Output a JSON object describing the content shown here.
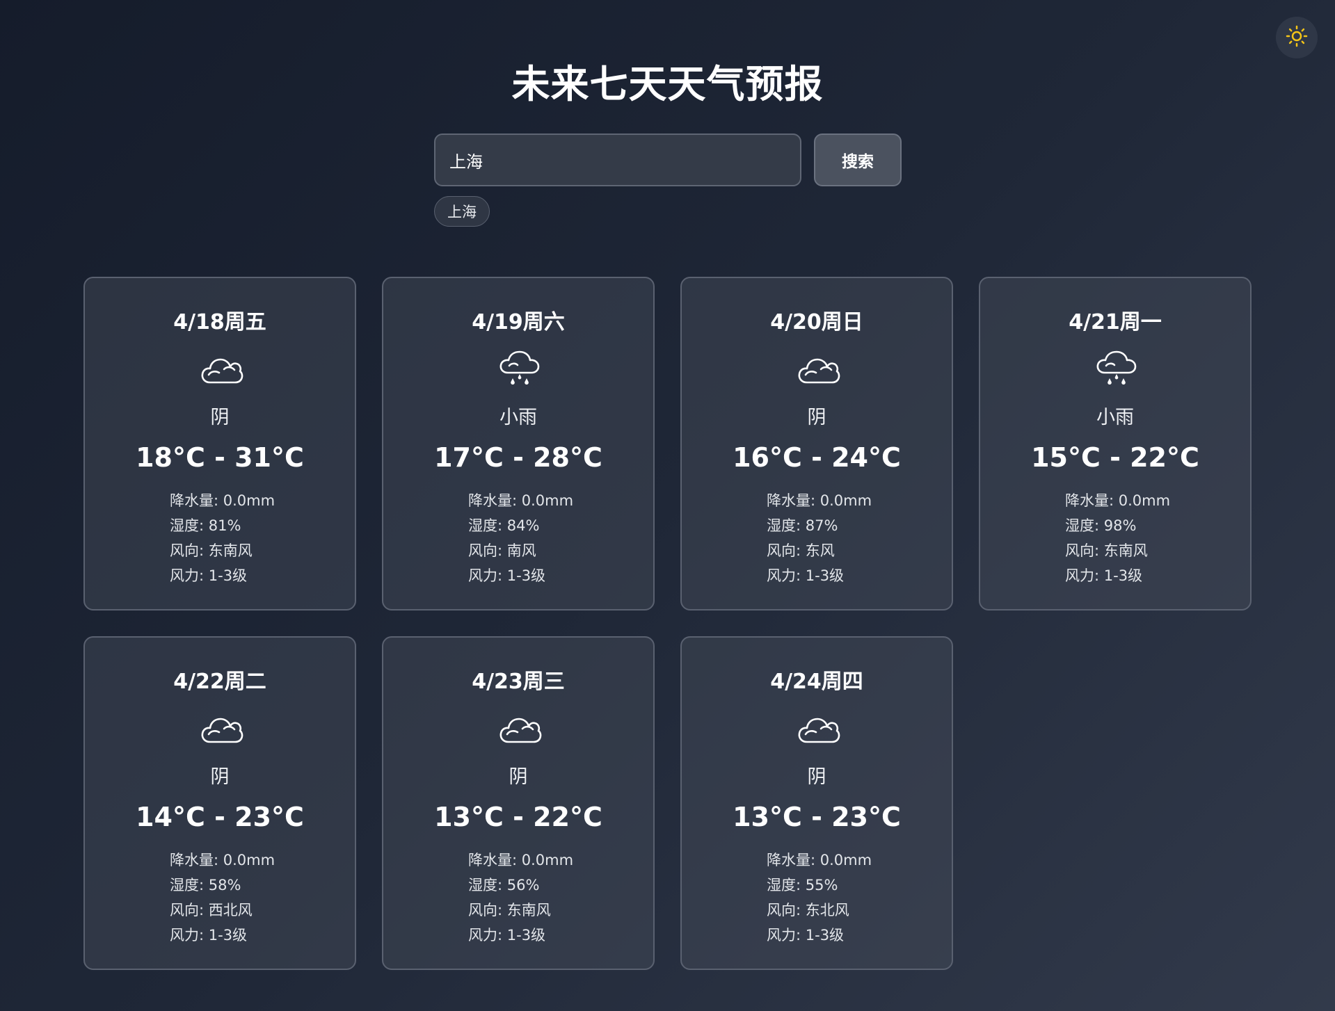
{
  "header": {
    "title": "未来七天天气预报",
    "theme_icon": "sun-icon"
  },
  "search": {
    "value": "上海",
    "button_label": "搜索",
    "history": [
      "上海"
    ]
  },
  "labels": {
    "precip": "降水量",
    "humidity": "湿度",
    "wind_dir": "风向",
    "wind_force": "风力"
  },
  "forecast": [
    {
      "date": "4/18周五",
      "icon": "cloudy-icon",
      "condition": "阴",
      "temp": "18°C - 31°C",
      "precip": "降水量: 0.0mm",
      "humidity": "湿度: 81%",
      "wind_dir": "风向: 东南风",
      "wind_force": "风力: 1-3级"
    },
    {
      "date": "4/19周六",
      "icon": "light-rain-icon",
      "condition": "小雨",
      "temp": "17°C - 28°C",
      "precip": "降水量: 0.0mm",
      "humidity": "湿度: 84%",
      "wind_dir": "风向: 南风",
      "wind_force": "风力: 1-3级"
    },
    {
      "date": "4/20周日",
      "icon": "cloudy-icon",
      "condition": "阴",
      "temp": "16°C - 24°C",
      "precip": "降水量: 0.0mm",
      "humidity": "湿度: 87%",
      "wind_dir": "风向: 东风",
      "wind_force": "风力: 1-3级"
    },
    {
      "date": "4/21周一",
      "icon": "light-rain-icon",
      "condition": "小雨",
      "temp": "15°C - 22°C",
      "precip": "降水量: 0.0mm",
      "humidity": "湿度: 98%",
      "wind_dir": "风向: 东南风",
      "wind_force": "风力: 1-3级"
    },
    {
      "date": "4/22周二",
      "icon": "cloudy-icon",
      "condition": "阴",
      "temp": "14°C - 23°C",
      "precip": "降水量: 0.0mm",
      "humidity": "湿度: 58%",
      "wind_dir": "风向: 西北风",
      "wind_force": "风力: 1-3级"
    },
    {
      "date": "4/23周三",
      "icon": "cloudy-icon",
      "condition": "阴",
      "temp": "13°C - 22°C",
      "precip": "降水量: 0.0mm",
      "humidity": "湿度: 56%",
      "wind_dir": "风向: 东南风",
      "wind_force": "风力: 1-3级"
    },
    {
      "date": "4/24周四",
      "icon": "cloudy-icon",
      "condition": "阴",
      "temp": "13°C - 23°C",
      "precip": "降水量: 0.0mm",
      "humidity": "湿度: 55%",
      "wind_dir": "风向: 东北风",
      "wind_force": "风力: 1-3级"
    }
  ],
  "colors": {
    "sun": "#f5c518",
    "card_border": "#5a6170",
    "background_start": "#151c2b",
    "background_end": "#323a4b"
  }
}
